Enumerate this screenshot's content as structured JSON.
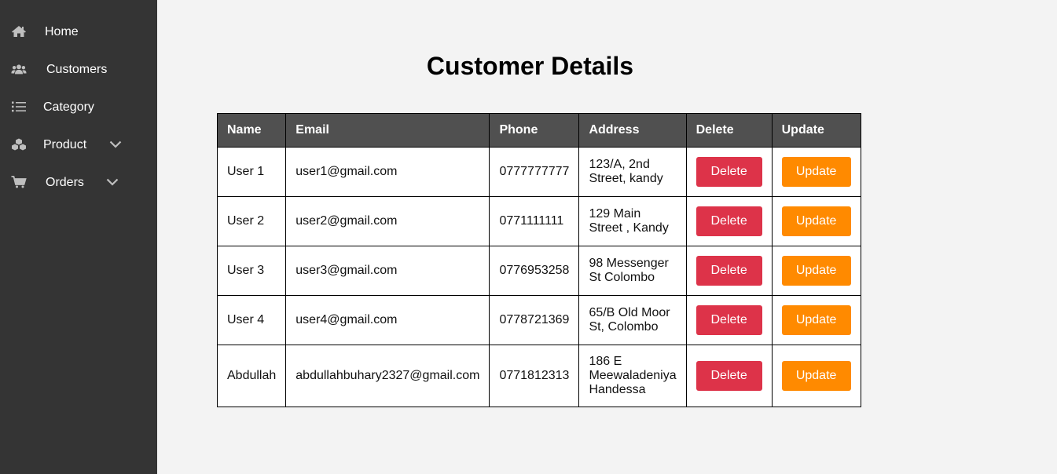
{
  "sidebar": {
    "items": [
      {
        "label": "Home",
        "icon": "home-icon"
      },
      {
        "label": "Customers",
        "icon": "users-icon"
      },
      {
        "label": "Category",
        "icon": "list-icon"
      },
      {
        "label": "Product",
        "icon": "cubes-icon",
        "has_submenu": true
      },
      {
        "label": "Orders",
        "icon": "cart-icon",
        "has_submenu": true
      }
    ]
  },
  "main": {
    "title": "Customer Details",
    "table": {
      "headers": [
        "Name",
        "Email",
        "Phone",
        "Address",
        "Delete",
        "Update"
      ],
      "rows": [
        {
          "name": "User 1",
          "email": "user1@gmail.com",
          "phone": "0777777777",
          "address": "123/A, 2nd Street, kandy"
        },
        {
          "name": "User 2",
          "email": "user2@gmail.com",
          "phone": "0771111111",
          "address": "129 Main Street , Kandy"
        },
        {
          "name": "User 3",
          "email": "user3@gmail.com",
          "phone": "0776953258",
          "address": "98 Messenger St Colombo"
        },
        {
          "name": "User 4",
          "email": "user4@gmail.com",
          "phone": "0778721369",
          "address": "65/B Old Moor St, Colombo"
        },
        {
          "name": "Abdullah",
          "email": "abdullahbuhary2327@gmail.com",
          "phone": "0771812313",
          "address": "186 E Meewaladeniya Handessa"
        }
      ],
      "delete_label": "Delete",
      "update_label": "Update"
    }
  },
  "colors": {
    "sidebar_bg": "#343434",
    "header_bg": "#505050",
    "delete": "#dd3349",
    "update": "#ff8a00",
    "page_bg": "#f3f3f3"
  }
}
